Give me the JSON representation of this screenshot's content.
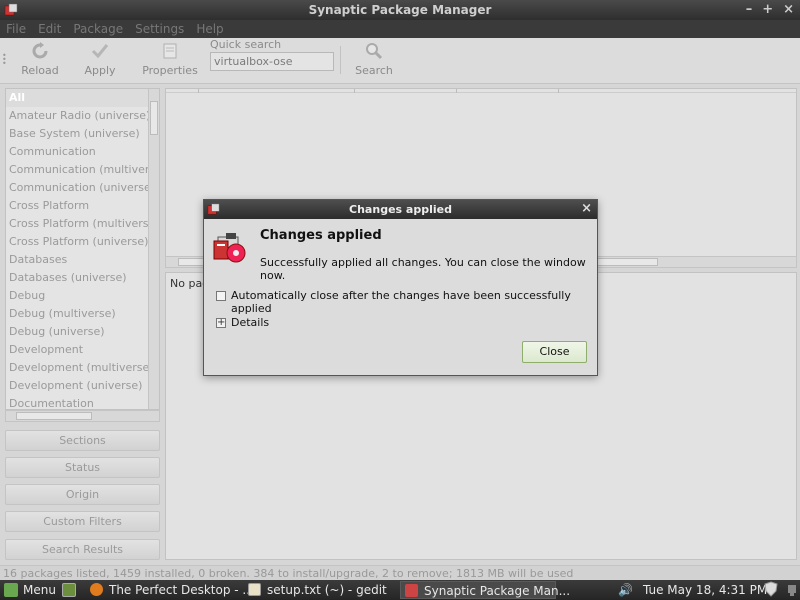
{
  "window": {
    "title": "Synaptic Package Manager"
  },
  "menu": {
    "file": "File",
    "edit": "Edit",
    "package": "Package",
    "settings": "Settings",
    "help": "Help"
  },
  "toolbar": {
    "reload": "Reload",
    "apply": "Apply",
    "properties": "Properties",
    "quick_search_label": "Quick search",
    "quick_search_value": "virtualbox-ose",
    "search": "Search"
  },
  "categories": [
    "All",
    "Amateur Radio (universe)",
    "Base System (universe)",
    "Communication",
    "Communication (multiverse)",
    "Communication (universe)",
    "Cross Platform",
    "Cross Platform (multiverse)",
    "Cross Platform (universe)",
    "Databases",
    "Databases (universe)",
    "Debug",
    "Debug (multiverse)",
    "Debug (universe)",
    "Development",
    "Development (multiverse)",
    "Development (universe)",
    "Documentation"
  ],
  "filters": {
    "sections": "Sections",
    "status": "Status",
    "origin": "Origin",
    "custom": "Custom Filters",
    "results": "Search Results"
  },
  "description": {
    "text": "No packa"
  },
  "status_bar": "16 packages listed, 1459 installed, 0 broken. 384 to install/upgrade, 2 to remove; 1813 MB will be used",
  "dialog": {
    "title": "Changes applied",
    "heading": "Changes applied",
    "message": "Successfully applied all changes. You can close the window now.",
    "auto_close": "Automatically close after the changes have been successfully applied",
    "details": "Details",
    "close_button": "Close"
  },
  "taskbar": {
    "menu": "Menu",
    "tasks": [
      "The Perfect Desktop - ...",
      "setup.txt (~) - gedit",
      "Synaptic Package Man..."
    ],
    "clock": "Tue May 18,  4:31 PM"
  },
  "colors": {
    "accent_green": "#8fae6c",
    "dark_bar": "#2e2e2e"
  }
}
